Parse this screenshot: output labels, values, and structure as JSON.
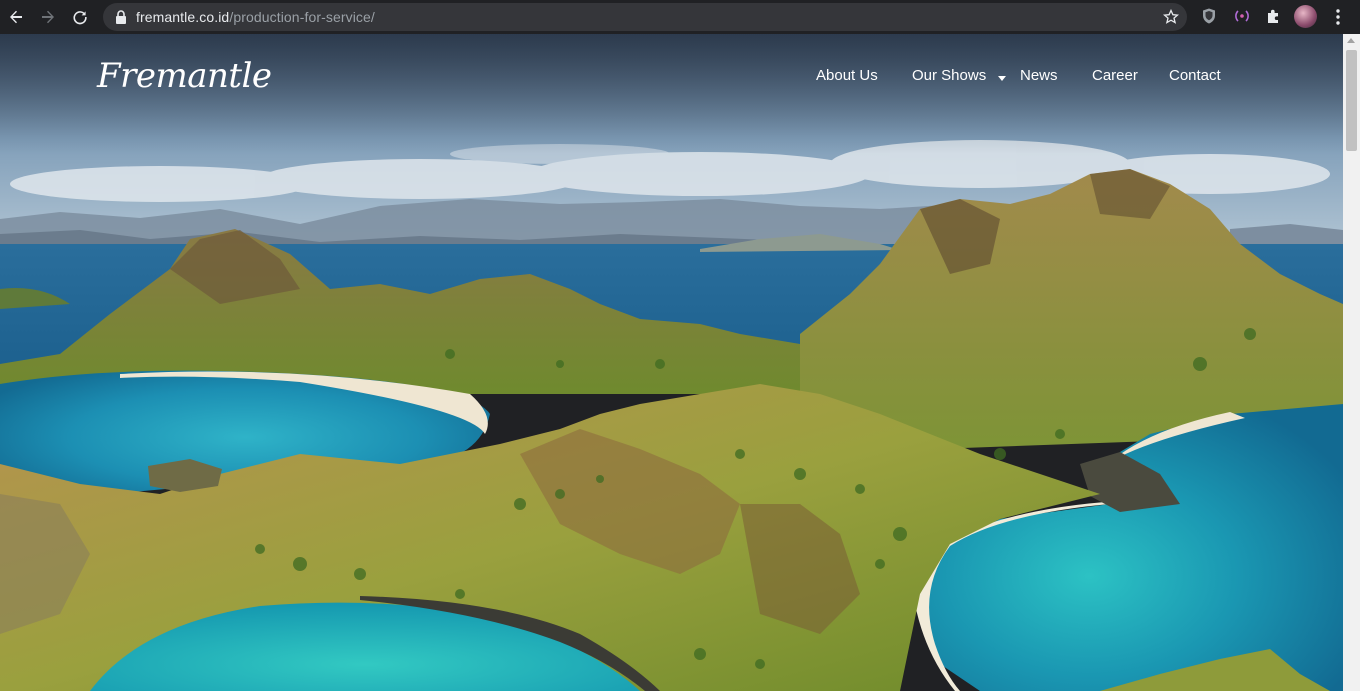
{
  "browser": {
    "url_host": "fremantle.co.id",
    "url_path": "/production-for-service/"
  },
  "site": {
    "logo_text": "Fremantle",
    "nav": [
      {
        "label": "About Us"
      },
      {
        "label": "Our Shows",
        "has_dropdown": true
      },
      {
        "label": "News"
      },
      {
        "label": "Career"
      },
      {
        "label": "Contact"
      }
    ]
  },
  "colors": {
    "chrome_bg": "#202124",
    "omnibox_bg": "#35363a",
    "nav_text": "#ffffff",
    "sea": "#1f78a8",
    "lagoon": "#2fc0c0",
    "hills": "#8e9b3a"
  },
  "icons": [
    "back-arrow-icon",
    "forward-arrow-icon",
    "reload-icon",
    "lock-icon",
    "star-icon",
    "shield-extension-icon",
    "radio-extension-icon",
    "puzzle-extension-icon",
    "profile-avatar",
    "kebab-menu-icon"
  ]
}
